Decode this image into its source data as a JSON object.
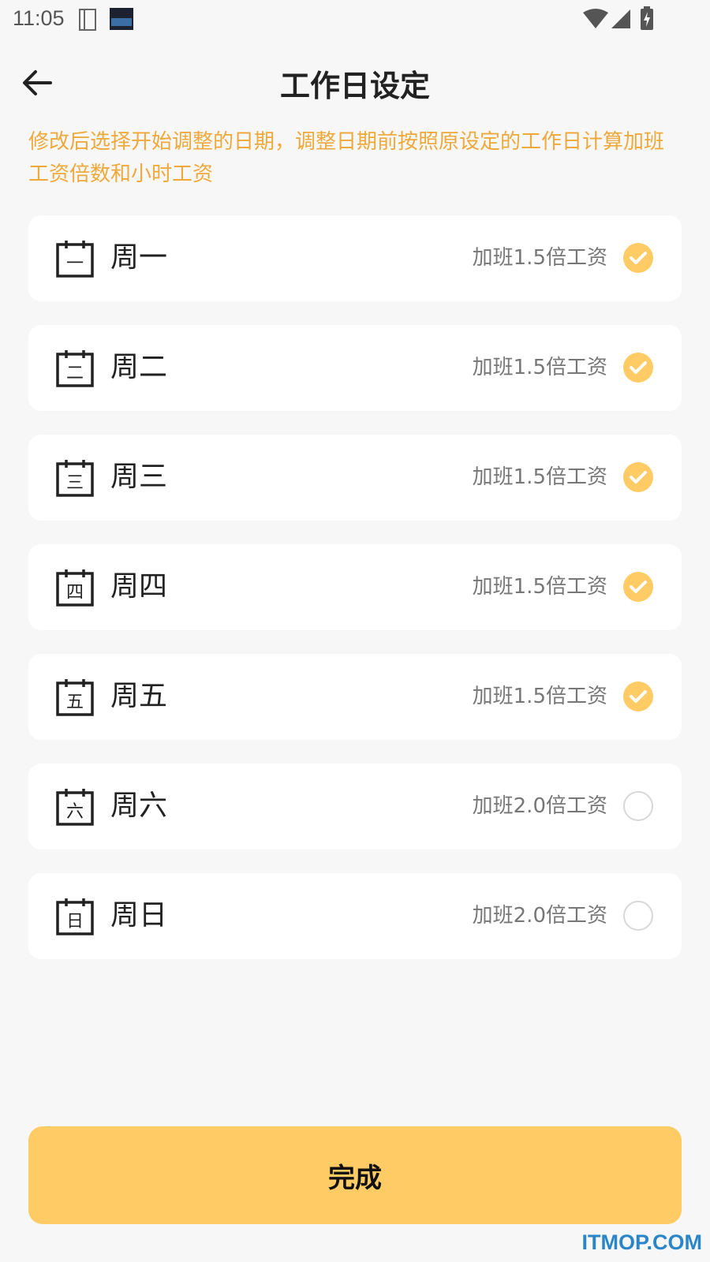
{
  "status_bar": {
    "time": "11:05",
    "icons": [
      "notebook-icon",
      "clock-widget-icon",
      "wifi-icon",
      "signal-icon",
      "battery-charging-icon"
    ]
  },
  "header": {
    "back_icon": "arrow-left-icon",
    "title": "工作日设定"
  },
  "notice": "修改后选择开始调整的日期，调整日期前按照原设定的工作日计算加班工资倍数和小时工资",
  "days": [
    {
      "icon_char": "一",
      "label": "周一",
      "rate": "加班1.5倍工资",
      "checked": true
    },
    {
      "icon_char": "二",
      "label": "周二",
      "rate": "加班1.5倍工资",
      "checked": true
    },
    {
      "icon_char": "三",
      "label": "周三",
      "rate": "加班1.5倍工资",
      "checked": true
    },
    {
      "icon_char": "四",
      "label": "周四",
      "rate": "加班1.5倍工资",
      "checked": true
    },
    {
      "icon_char": "五",
      "label": "周五",
      "rate": "加班1.5倍工资",
      "checked": true
    },
    {
      "icon_char": "六",
      "label": "周六",
      "rate": "加班2.0倍工资",
      "checked": false
    },
    {
      "icon_char": "日",
      "label": "周日",
      "rate": "加班2.0倍工资",
      "checked": false
    }
  ],
  "done_button": "完成",
  "watermark": "ITMOP.COM",
  "colors": {
    "accent": "#ffcb64",
    "notice_text": "#efa93b",
    "background": "#f7f7f7"
  }
}
